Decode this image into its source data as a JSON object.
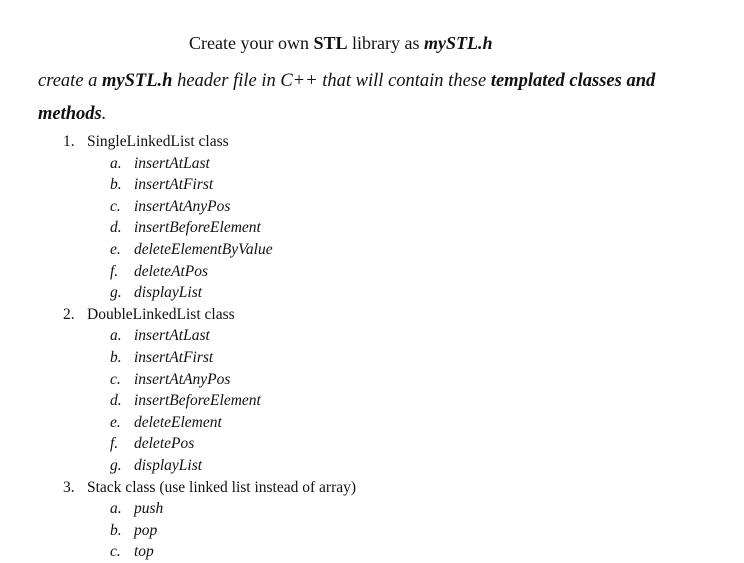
{
  "title": {
    "pre": "Create your own ",
    "bold": "STL",
    "mid": " library as ",
    "bold_italic": "mySTL.h"
  },
  "intro": {
    "part1": "create a ",
    "bold1": "mySTL.h",
    "part2": " header file in C++ that will contain these ",
    "bold2": "templated classes and methods",
    "end": "."
  },
  "classes": [
    {
      "number": "1.",
      "name": "SingleLinkedList class",
      "methods": [
        {
          "letter": "a.",
          "name": "insertAtLast"
        },
        {
          "letter": "b.",
          "name": "insertAtFirst"
        },
        {
          "letter": "c.",
          "name": "insertAtAnyPos"
        },
        {
          "letter": "d.",
          "name": "insertBeforeElement"
        },
        {
          "letter": "e.",
          "name": "deleteElementByValue"
        },
        {
          "letter": "f.",
          "name": "deleteAtPos"
        },
        {
          "letter": "g.",
          "name": "displayList"
        }
      ]
    },
    {
      "number": "2.",
      "name": "DoubleLinkedList class",
      "methods": [
        {
          "letter": "a.",
          "name": "insertAtLast"
        },
        {
          "letter": "b.",
          "name": "insertAtFirst"
        },
        {
          "letter": "c.",
          "name": "insertAtAnyPos"
        },
        {
          "letter": "d.",
          "name": "insertBeforeElement"
        },
        {
          "letter": "e.",
          "name": "deleteElement"
        },
        {
          "letter": "f.",
          "name": "deletePos"
        },
        {
          "letter": "g.",
          "name": "displayList"
        }
      ]
    },
    {
      "number": "3.",
      "name": "Stack class (use linked list instead of array)",
      "methods": [
        {
          "letter": "a.",
          "name": "push"
        },
        {
          "letter": "b.",
          "name": "pop"
        },
        {
          "letter": "c.",
          "name": "top"
        }
      ]
    }
  ]
}
